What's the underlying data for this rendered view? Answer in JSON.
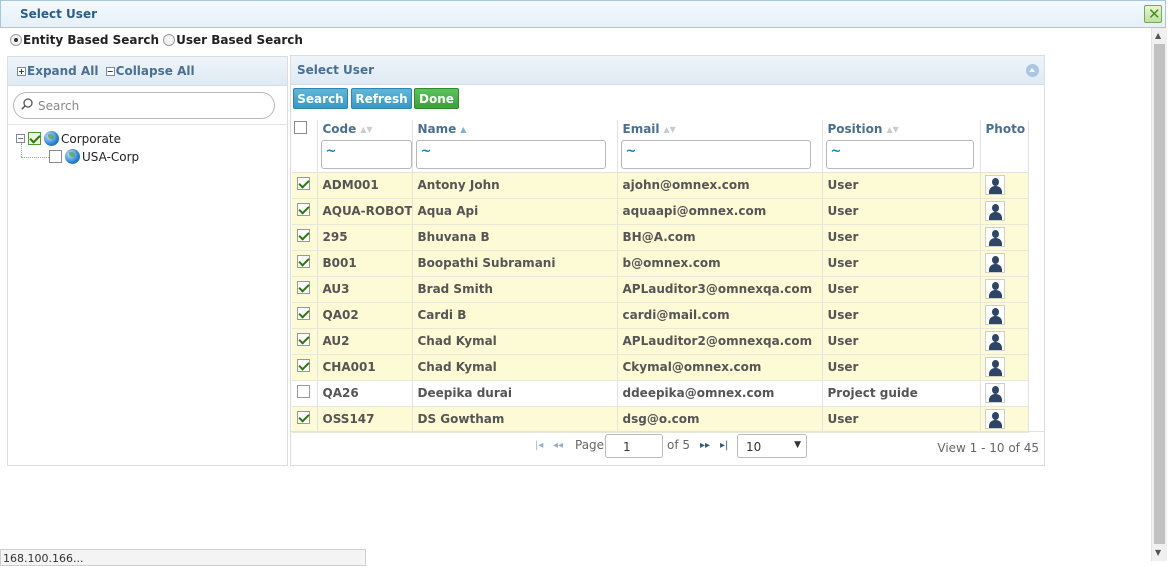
{
  "dialog": {
    "title": "Select User"
  },
  "search_mode": {
    "options": [
      {
        "label": "Entity Based Search",
        "selected": true
      },
      {
        "label": "User Based Search",
        "selected": false
      }
    ]
  },
  "tree": {
    "expand_all": "Expand All",
    "collapse_all": "Collapse All",
    "search_placeholder": "Search",
    "nodes": [
      {
        "label": "Corporate",
        "checked": true,
        "expanded": true
      },
      {
        "label": "USA-Corp",
        "checked": false
      }
    ]
  },
  "grid": {
    "title": "Select User",
    "buttons": {
      "search": "Search",
      "refresh": "Refresh",
      "done": "Done"
    },
    "columns": [
      "Code",
      "Name",
      "Email",
      "Position",
      "Photo"
    ],
    "filter_placeholder": "~",
    "rows": [
      {
        "checked": true,
        "code": "ADM001",
        "name": "Antony John",
        "email": "ajohn@omnex.com",
        "position": "User"
      },
      {
        "checked": true,
        "code": "AQUA-ROBOT",
        "name": "Aqua Api",
        "email": "aquaapi@omnex.com",
        "position": "User"
      },
      {
        "checked": true,
        "code": "295",
        "name": "Bhuvana  B",
        "email": "BH@A.com",
        "position": "User"
      },
      {
        "checked": true,
        "code": "B001",
        "name": "Boopathi Subramani",
        "email": "b@omnex.com",
        "position": "User"
      },
      {
        "checked": true,
        "code": "AU3",
        "name": "Brad Smith",
        "email": "APLauditor3@omnexqa.com",
        "position": "User"
      },
      {
        "checked": true,
        "code": "QA02",
        "name": "Cardi  B",
        "email": "cardi@mail.com",
        "position": "User"
      },
      {
        "checked": true,
        "code": "AU2",
        "name": "Chad Kymal",
        "email": "APLauditor2@omnexqa.com",
        "position": "User"
      },
      {
        "checked": true,
        "code": "CHA001",
        "name": "Chad Kymal",
        "email": "Ckymal@omnex.com",
        "position": "User"
      },
      {
        "checked": false,
        "code": "QA26",
        "name": "Deepika durai",
        "email": "ddeepika@omnex.com",
        "position": "Project guide"
      },
      {
        "checked": true,
        "code": "OSS147",
        "name": "DS Gowtham",
        "email": "dsg@o.com",
        "position": "User"
      }
    ],
    "pager": {
      "page_label": "Page",
      "page_value": "1",
      "of_label": "of 5",
      "rows_per_page": "10",
      "view_label": "View 1 - 10 of 45"
    }
  },
  "status_bar": {
    "text": "168.100.166..."
  },
  "colors": {
    "header_text": "#4a6f93",
    "selected_row": "#fdfbd6",
    "button_blue": "#3a98c6",
    "button_green": "#3ba23b"
  }
}
